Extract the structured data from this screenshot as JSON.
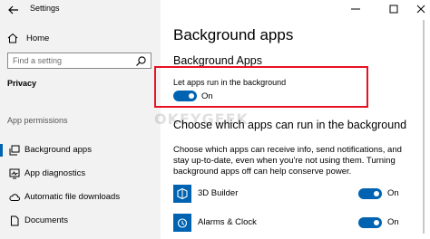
{
  "window": {
    "title": "Settings"
  },
  "sidebar": {
    "home_label": "Home",
    "search_placeholder": "Find a setting",
    "section_title": "Privacy",
    "group_label": "App permissions",
    "items": [
      {
        "label": "Background apps",
        "icon": "background-apps-icon",
        "selected": true
      },
      {
        "label": "App diagnostics",
        "icon": "diagnostics-icon",
        "selected": false
      },
      {
        "label": "Automatic file downloads",
        "icon": "cloud-icon",
        "selected": false
      },
      {
        "label": "Documents",
        "icon": "document-icon",
        "selected": false
      }
    ]
  },
  "main": {
    "page_title": "Background apps",
    "section1_title": "Background Apps",
    "master_toggle": {
      "label": "Let apps run in the background",
      "state": "On"
    },
    "section2_title": "Choose which apps can run in the background",
    "description": "Choose which apps can receive info, send notifications, and stay up-to-date, even when you're not using them. Turning background apps off can help conserve power.",
    "apps": [
      {
        "name": "3D Builder",
        "state": "On",
        "icon": "3d-builder-icon"
      },
      {
        "name": "Alarms & Clock",
        "state": "On",
        "icon": "alarm-clock-icon"
      }
    ]
  },
  "watermark": "OKEYGEEK",
  "colors": {
    "accent": "#0063b1",
    "highlight": "#e81123",
    "sidebar_bg": "#f2f2f2"
  }
}
